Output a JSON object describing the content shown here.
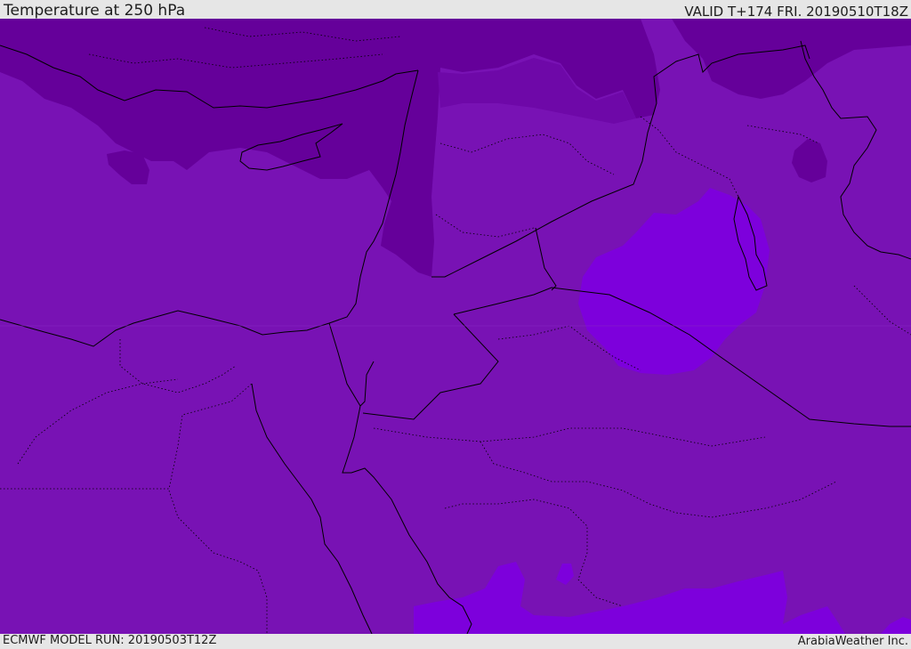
{
  "header": {
    "title": "Temperature at 250 hPa",
    "valid_time": "VALID T+174 FRI. 20190510T18Z"
  },
  "footer": {
    "model_run": "ECMWF MODEL RUN: 20190503T12Z",
    "credit": "ArabiaWeather Inc."
  },
  "map": {
    "colors": {
      "base_field": "#7812b4",
      "cold_field": "#65009a",
      "cold_mid_field": "#6e08a8",
      "warm_field": "#7d00dc",
      "border_line": "#000000",
      "frame_bg": "#e6e6e6"
    }
  }
}
